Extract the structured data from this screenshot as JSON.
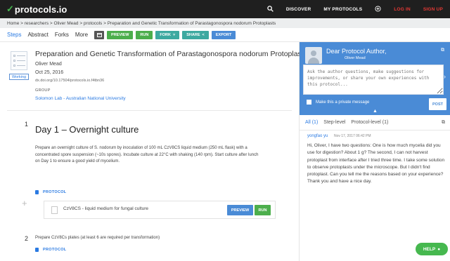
{
  "header": {
    "logo_text": "protocols.io",
    "nav": {
      "discover": "DISCOVER",
      "my_protocols": "MY PROTOCOLS",
      "login": "LOG IN",
      "signup": "SIGN UP"
    }
  },
  "breadcrumb": "Home > researchers > Oliver Mead > protocols > Preparation and Genetic Transformation of Parastagonospora nodorum Protoplasts",
  "toolbar": {
    "tabs": [
      "Steps",
      "Abstract",
      "Forks",
      "More"
    ],
    "buttons": [
      "PREVIEW",
      "RUN",
      "FORK",
      "SHARE",
      "EXPORT"
    ]
  },
  "protocol": {
    "status": "Working",
    "title": "Preparation and Genetic Transformation of Parastagonospora nodorum Protoplasts",
    "author": "Oliver Mead",
    "date": "Oct 25, 2016",
    "doi": "dx.doi.org/10.17504/protocols.io.f4tbn36",
    "group_label": "GROUP",
    "group_name": "Solomon Lab - Australian National University"
  },
  "steps": [
    {
      "number": "1",
      "title": "Day 1 – Overnight culture",
      "description": "Prepare an overnight culture of S. nodorum by inoculation of 100 mL CzV8CS liquid medium (250 mL flask) with a concentrated spore suspension (~10s spores). Incubate culture at 22°C with shaking (140 rpm). Start culture after lunch on Day 1 to ensure a good yield of mycelium.",
      "protocol_label": "PROTOCOL",
      "linked_protocol": {
        "name": "CzV8CS - liquid medium for fungal culture",
        "preview_label": "PREVIEW",
        "run_label": "RUN"
      }
    },
    {
      "number": "2",
      "description": "Prepare CzV8Cs plates (at least 6 are required per transformation)",
      "protocol_label": "PROTOCOL"
    }
  ],
  "sidebar": {
    "greeting": "Dear Protocol Author,",
    "subtitle": "Oliver Mead",
    "placeholder": "Ask the author questions, make suggestions for improvements, or share your own experiences with this protocol...",
    "private_label": "Make this a private message",
    "post_label": "POST",
    "tabs": [
      "All (1)",
      "Step-level",
      "Protocol-level (1)"
    ],
    "comment": {
      "user": "yongfao yu",
      "date": "Nov 17, 2017 06:42 PM",
      "text": "Hi, Oliver, I have two questions: One is how much mycelia did you use for digestion? About 1 g? The second, I can not harvest protoplast from interface after I tried three time. I take some solution to observe protoplasts under the microscope. But I didn't find protoplast. Can you tell me the reasons based on your experience? Thank you and have a nice day."
    }
  },
  "help_label": "HELP"
}
